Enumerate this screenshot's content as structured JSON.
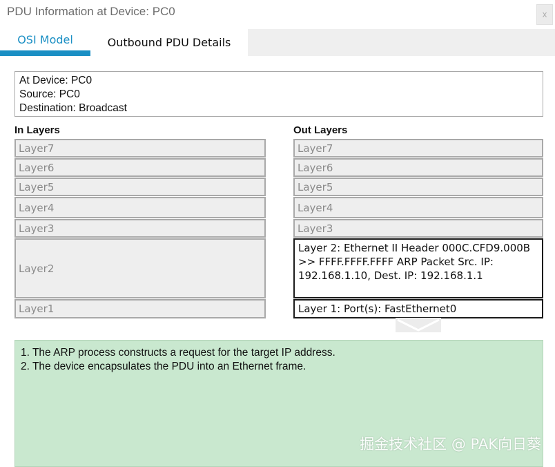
{
  "window": {
    "title": "PDU Information at Device: PC0",
    "close_glyph": "x"
  },
  "tabs": [
    {
      "label": "OSI Model",
      "active": true
    },
    {
      "label": "Outbound PDU Details",
      "active": false
    }
  ],
  "info": {
    "line1": "At Device: PC0",
    "line2": "Source: PC0",
    "line3": "Destination: Broadcast"
  },
  "in_layers": {
    "heading": "In Layers",
    "items": [
      "Layer7",
      "Layer6",
      "Layer5",
      "Layer4",
      "Layer3",
      "Layer2",
      "Layer1"
    ]
  },
  "out_layers": {
    "heading": "Out Layers",
    "items": [
      "Layer7",
      "Layer6",
      "Layer5",
      "Layer4",
      "Layer3",
      "Layer 2: Ethernet II Header 000C.CFD9.000B >> FFFF.FFFF.FFFF ARP Packet Src. IP: 192.168.1.10, Dest. IP: 192.168.1.1",
      "Layer 1: Port(s): FastEthernet0"
    ]
  },
  "notes": [
    "1. The ARP process constructs a request for the target IP address.",
    "2. The device encapsulates the PDU into an Ethernet frame."
  ],
  "watermark": "掘金技术社区 @ PAK向日葵",
  "colors": {
    "accent": "#1a8fc4",
    "notes_bg": "#c9e8cf",
    "inactive_layer_bg": "#eeeeee"
  }
}
